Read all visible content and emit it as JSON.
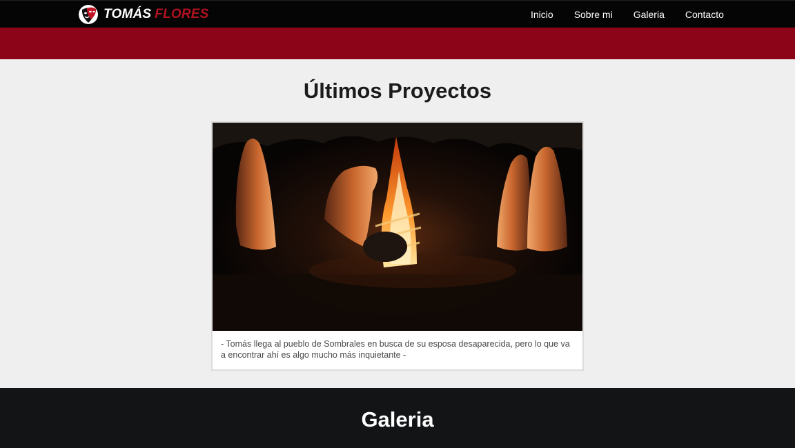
{
  "navbar": {
    "brand": {
      "first": "TOMÁS",
      "last": "FLORES",
      "icon": "theater-masks-icon"
    },
    "links": [
      "Inicio",
      "Sobre mi",
      "Galeria",
      "Contacto"
    ]
  },
  "projects": {
    "title": "Últimos Proyectos",
    "card": {
      "image": "bonfire-hooded-figures-still",
      "caption": "- Tomás llega al pueblo de Sombrales en busca de su esposa desaparecida, pero lo que va a encontrar ahí es algo mucho más inquietante -"
    }
  },
  "gallery": {
    "title": "Galeria"
  },
  "colors": {
    "navbar_bg": "#050505",
    "accent_red": "#8c0417",
    "page_bg": "#efefef",
    "footer_bg": "#121416"
  }
}
